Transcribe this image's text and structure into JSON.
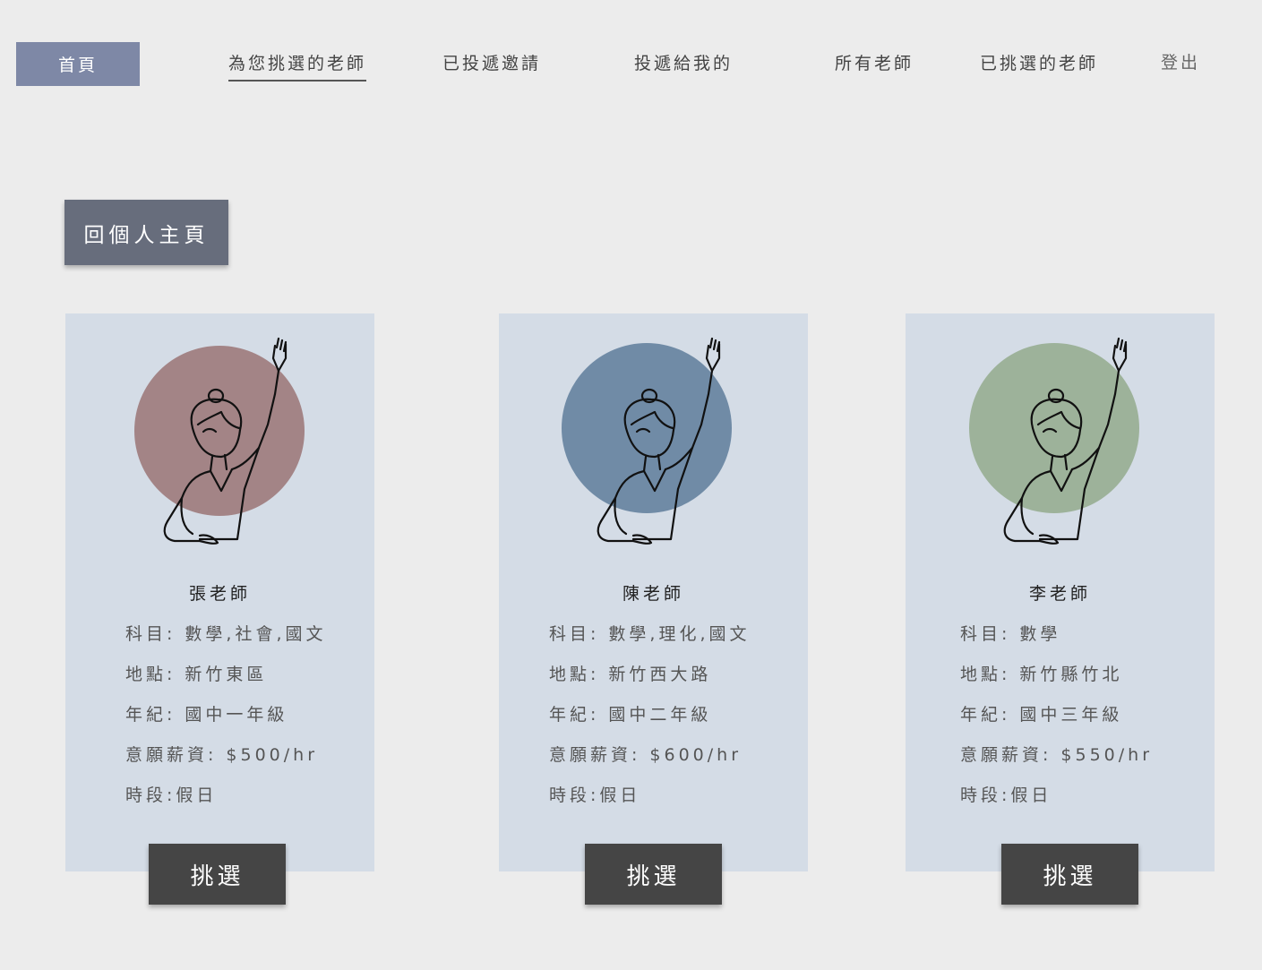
{
  "nav": {
    "home": "首頁",
    "items": [
      {
        "label": "為您挑選的老師"
      },
      {
        "label": "已投遞邀請"
      },
      {
        "label": "投遞給我的"
      },
      {
        "label": "所有老師"
      },
      {
        "label": "已挑選的老師"
      },
      {
        "label": "登出"
      }
    ]
  },
  "back_button": "回個人主頁",
  "labels": {
    "subject": "科目:",
    "location": "地點:",
    "grade": "年紀:",
    "salary": "意願薪資:",
    "period": "時段:"
  },
  "teachers": [
    {
      "name": "張老師",
      "subject": "數學,社會,國文",
      "location": "新竹東區",
      "grade": "國中一年級",
      "salary": "$500/hr",
      "period": "假日",
      "button": "挑選",
      "avatar_color": "#a38486",
      "avatar_icon": "raised-hand-person-icon"
    },
    {
      "name": "陳老師",
      "subject": "數學,理化,國文",
      "location": "新竹西大路",
      "grade": "國中二年級",
      "salary": "$600/hr",
      "period": "假日",
      "button": "挑選",
      "avatar_color": "#708ba6",
      "avatar_icon": "raised-hand-person-icon"
    },
    {
      "name": "李老師",
      "subject": "數學",
      "location": "新竹縣竹北",
      "grade": "國中三年級",
      "salary": "$550/hr",
      "period": "假日",
      "button": "挑選",
      "avatar_color": "#9db29a",
      "avatar_icon": "raised-hand-person-icon"
    }
  ],
  "colors": {
    "background": "#ececec",
    "card": "#d4dce6",
    "nav_home": "#7e88a6",
    "back_button": "#676d7c",
    "pick_button": "#454545"
  }
}
